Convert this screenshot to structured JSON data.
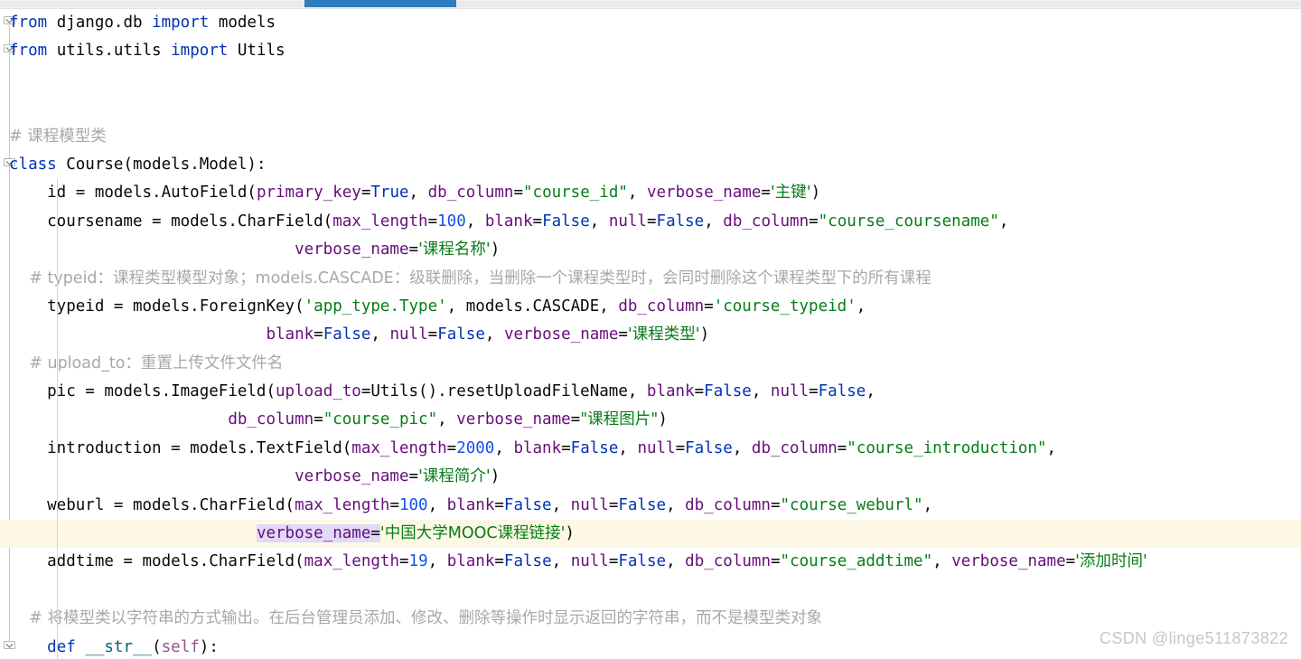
{
  "window": {
    "app": "code-editor",
    "watermark": "CSDN @linge511873822"
  },
  "scrollbar": {
    "orientation": "horizontal",
    "thumb_color": "#2f7cbf",
    "track_color": "#eaeaea"
  },
  "theme": {
    "background": "#ffffff",
    "keyword": "#0033b3",
    "string": "#067d17",
    "number": "#1750eb",
    "kwarg_name": "#660e7a",
    "comment": "#a8a8a8",
    "function": "#00627a",
    "self": "#94558d",
    "caret_line": "#fdf8e5",
    "selection": "#e0d9f7",
    "indent_guide": "#d4d4d4"
  },
  "code": {
    "language": "python",
    "lines": [
      {
        "n": 1,
        "fold": "open",
        "tokens": [
          {
            "t": "from",
            "c": "kw"
          },
          {
            "t": " django.db ",
            "c": "plain"
          },
          {
            "t": "import",
            "c": "kw"
          },
          {
            "t": " models",
            "c": "plain"
          }
        ]
      },
      {
        "n": 2,
        "fold": "open",
        "tokens": [
          {
            "t": "from",
            "c": "kw"
          },
          {
            "t": " utils.utils ",
            "c": "plain"
          },
          {
            "t": "import",
            "c": "kw"
          },
          {
            "t": " Utils",
            "c": "plain"
          }
        ]
      },
      {
        "n": 3,
        "fold": "",
        "tokens": []
      },
      {
        "n": 4,
        "fold": "",
        "tokens": []
      },
      {
        "n": 5,
        "fold": "",
        "tokens": [
          {
            "t": "# 课程模型类",
            "c": "cmt"
          }
        ]
      },
      {
        "n": 6,
        "fold": "open",
        "tokens": [
          {
            "t": "class",
            "c": "kw"
          },
          {
            "t": " Course(models.Model):",
            "c": "plain"
          }
        ]
      },
      {
        "n": 7,
        "fold": "",
        "indent": 1,
        "tokens": [
          {
            "t": "    id = models.AutoField(",
            "c": "plain"
          },
          {
            "t": "primary_key",
            "c": "named"
          },
          {
            "t": "=",
            "c": "plain"
          },
          {
            "t": "True",
            "c": "bool"
          },
          {
            "t": ", ",
            "c": "plain"
          },
          {
            "t": "db_column",
            "c": "named"
          },
          {
            "t": "=",
            "c": "plain"
          },
          {
            "t": "\"course_id\"",
            "c": "str-d"
          },
          {
            "t": ", ",
            "c": "plain"
          },
          {
            "t": "verbose_name",
            "c": "named"
          },
          {
            "t": "=",
            "c": "plain"
          },
          {
            "t": "'主键'",
            "c": "str-s"
          },
          {
            "t": ")",
            "c": "plain"
          }
        ]
      },
      {
        "n": 8,
        "fold": "",
        "indent": 1,
        "tokens": [
          {
            "t": "    coursename = models.CharField(",
            "c": "plain"
          },
          {
            "t": "max_length",
            "c": "named"
          },
          {
            "t": "=",
            "c": "plain"
          },
          {
            "t": "100",
            "c": "num"
          },
          {
            "t": ", ",
            "c": "plain"
          },
          {
            "t": "blank",
            "c": "named"
          },
          {
            "t": "=",
            "c": "plain"
          },
          {
            "t": "False",
            "c": "bool"
          },
          {
            "t": ", ",
            "c": "plain"
          },
          {
            "t": "null",
            "c": "named"
          },
          {
            "t": "=",
            "c": "plain"
          },
          {
            "t": "False",
            "c": "bool"
          },
          {
            "t": ", ",
            "c": "plain"
          },
          {
            "t": "db_column",
            "c": "named"
          },
          {
            "t": "=",
            "c": "plain"
          },
          {
            "t": "\"course_coursename\"",
            "c": "str-d"
          },
          {
            "t": ",",
            "c": "plain"
          }
        ]
      },
      {
        "n": 9,
        "fold": "",
        "indent": 2,
        "tokens": [
          {
            "t": "                              ",
            "c": "plain"
          },
          {
            "t": "verbose_name",
            "c": "named"
          },
          {
            "t": "=",
            "c": "plain"
          },
          {
            "t": "'课程名称'",
            "c": "str-s"
          },
          {
            "t": ")",
            "c": "plain"
          }
        ]
      },
      {
        "n": 10,
        "fold": "",
        "indent": 1,
        "tokens": [
          {
            "t": "    # typeid：课程类型模型对象；models.CASCADE：级联删除，当删除一个课程类型时，会同时删除这个课程类型下的所有课程",
            "c": "cmt"
          }
        ]
      },
      {
        "n": 11,
        "fold": "",
        "indent": 1,
        "tokens": [
          {
            "t": "    typeid = models.ForeignKey(",
            "c": "plain"
          },
          {
            "t": "'app_type.Type'",
            "c": "str-s"
          },
          {
            "t": ", models.CASCADE, ",
            "c": "plain"
          },
          {
            "t": "db_column",
            "c": "named"
          },
          {
            "t": "=",
            "c": "plain"
          },
          {
            "t": "'course_typeid'",
            "c": "str-s"
          },
          {
            "t": ",",
            "c": "plain"
          }
        ]
      },
      {
        "n": 12,
        "fold": "",
        "indent": 2,
        "tokens": [
          {
            "t": "                           ",
            "c": "plain"
          },
          {
            "t": "blank",
            "c": "named"
          },
          {
            "t": "=",
            "c": "plain"
          },
          {
            "t": "False",
            "c": "bool"
          },
          {
            "t": ", ",
            "c": "plain"
          },
          {
            "t": "null",
            "c": "named"
          },
          {
            "t": "=",
            "c": "plain"
          },
          {
            "t": "False",
            "c": "bool"
          },
          {
            "t": ", ",
            "c": "plain"
          },
          {
            "t": "verbose_name",
            "c": "named"
          },
          {
            "t": "=",
            "c": "plain"
          },
          {
            "t": "'课程类型'",
            "c": "str-s"
          },
          {
            "t": ")",
            "c": "plain"
          }
        ]
      },
      {
        "n": 13,
        "fold": "",
        "indent": 1,
        "tokens": [
          {
            "t": "    # upload_to：重置上传文件文件名",
            "c": "cmt"
          }
        ]
      },
      {
        "n": 14,
        "fold": "",
        "indent": 1,
        "tokens": [
          {
            "t": "    pic = models.ImageField(",
            "c": "plain"
          },
          {
            "t": "upload_to",
            "c": "named"
          },
          {
            "t": "=Utils().resetUploadFileName, ",
            "c": "plain"
          },
          {
            "t": "blank",
            "c": "named"
          },
          {
            "t": "=",
            "c": "plain"
          },
          {
            "t": "False",
            "c": "bool"
          },
          {
            "t": ", ",
            "c": "plain"
          },
          {
            "t": "null",
            "c": "named"
          },
          {
            "t": "=",
            "c": "plain"
          },
          {
            "t": "False",
            "c": "bool"
          },
          {
            "t": ",",
            "c": "plain"
          }
        ]
      },
      {
        "n": 15,
        "fold": "",
        "indent": 2,
        "tokens": [
          {
            "t": "                       ",
            "c": "plain"
          },
          {
            "t": "db_column",
            "c": "named"
          },
          {
            "t": "=",
            "c": "plain"
          },
          {
            "t": "\"course_pic\"",
            "c": "str-d"
          },
          {
            "t": ", ",
            "c": "plain"
          },
          {
            "t": "verbose_name",
            "c": "named"
          },
          {
            "t": "=",
            "c": "plain"
          },
          {
            "t": "\"课程图片\"",
            "c": "str-d"
          },
          {
            "t": ")",
            "c": "plain"
          }
        ]
      },
      {
        "n": 16,
        "fold": "",
        "indent": 1,
        "tokens": [
          {
            "t": "    introduction = models.TextField(",
            "c": "plain"
          },
          {
            "t": "max_length",
            "c": "named"
          },
          {
            "t": "=",
            "c": "plain"
          },
          {
            "t": "2000",
            "c": "num"
          },
          {
            "t": ", ",
            "c": "plain"
          },
          {
            "t": "blank",
            "c": "named"
          },
          {
            "t": "=",
            "c": "plain"
          },
          {
            "t": "False",
            "c": "bool"
          },
          {
            "t": ", ",
            "c": "plain"
          },
          {
            "t": "null",
            "c": "named"
          },
          {
            "t": "=",
            "c": "plain"
          },
          {
            "t": "False",
            "c": "bool"
          },
          {
            "t": ", ",
            "c": "plain"
          },
          {
            "t": "db_column",
            "c": "named"
          },
          {
            "t": "=",
            "c": "plain"
          },
          {
            "t": "\"course_introduction\"",
            "c": "str-d"
          },
          {
            "t": ",",
            "c": "plain"
          }
        ]
      },
      {
        "n": 17,
        "fold": "",
        "indent": 2,
        "tokens": [
          {
            "t": "                              ",
            "c": "plain"
          },
          {
            "t": "verbose_name",
            "c": "named"
          },
          {
            "t": "=",
            "c": "plain"
          },
          {
            "t": "'课程简介'",
            "c": "str-s"
          },
          {
            "t": ")",
            "c": "plain"
          }
        ]
      },
      {
        "n": 18,
        "fold": "",
        "indent": 1,
        "tokens": [
          {
            "t": "    weburl = models.CharField(",
            "c": "plain"
          },
          {
            "t": "max_length",
            "c": "named"
          },
          {
            "t": "=",
            "c": "plain"
          },
          {
            "t": "100",
            "c": "num"
          },
          {
            "t": ", ",
            "c": "plain"
          },
          {
            "t": "blank",
            "c": "named"
          },
          {
            "t": "=",
            "c": "plain"
          },
          {
            "t": "False",
            "c": "bool"
          },
          {
            "t": ", ",
            "c": "plain"
          },
          {
            "t": "null",
            "c": "named"
          },
          {
            "t": "=",
            "c": "plain"
          },
          {
            "t": "False",
            "c": "bool"
          },
          {
            "t": ", ",
            "c": "plain"
          },
          {
            "t": "db_column",
            "c": "named"
          },
          {
            "t": "=",
            "c": "plain"
          },
          {
            "t": "\"course_weburl\"",
            "c": "str-d"
          },
          {
            "t": ",",
            "c": "plain"
          }
        ]
      },
      {
        "n": 19,
        "fold": "",
        "indent": 2,
        "caret": true,
        "selection": "verbose_name=",
        "tokens": [
          {
            "t": "                          ",
            "c": "plain"
          },
          {
            "t": "verbose_name",
            "c": "named sel"
          },
          {
            "t": "=",
            "c": "plain sel"
          },
          {
            "t": "'中国大学MOOC课程链接'",
            "c": "str-s"
          },
          {
            "t": ")",
            "c": "plain"
          }
        ]
      },
      {
        "n": 20,
        "fold": "",
        "indent": 1,
        "tokens": [
          {
            "t": "    addtime = models.CharField(",
            "c": "plain"
          },
          {
            "t": "max_length",
            "c": "named"
          },
          {
            "t": "=",
            "c": "plain"
          },
          {
            "t": "19",
            "c": "num"
          },
          {
            "t": ", ",
            "c": "plain"
          },
          {
            "t": "blank",
            "c": "named"
          },
          {
            "t": "=",
            "c": "plain"
          },
          {
            "t": "False",
            "c": "bool"
          },
          {
            "t": ", ",
            "c": "plain"
          },
          {
            "t": "null",
            "c": "named"
          },
          {
            "t": "=",
            "c": "plain"
          },
          {
            "t": "False",
            "c": "bool"
          },
          {
            "t": ", ",
            "c": "plain"
          },
          {
            "t": "db_column",
            "c": "named"
          },
          {
            "t": "=",
            "c": "plain"
          },
          {
            "t": "\"course_addtime\"",
            "c": "str-d"
          },
          {
            "t": ", ",
            "c": "plain"
          },
          {
            "t": "verbose_name",
            "c": "named"
          },
          {
            "t": "=",
            "c": "plain"
          },
          {
            "t": "'添加时间'",
            "c": "str-s"
          }
        ]
      },
      {
        "n": 21,
        "fold": "",
        "indent": 1,
        "tokens": []
      },
      {
        "n": 22,
        "fold": "",
        "indent": 1,
        "tokens": [
          {
            "t": "    # 将模型类以字符串的方式输出。在后台管理员添加、修改、删除等操作时显示返回的字符串，而不是模型类对象",
            "c": "cmt"
          }
        ]
      },
      {
        "n": 23,
        "fold": "open",
        "indent": 1,
        "tokens": [
          {
            "t": "    ",
            "c": "plain"
          },
          {
            "t": "def",
            "c": "kw"
          },
          {
            "t": " ",
            "c": "plain"
          },
          {
            "t": "__str__",
            "c": "fn"
          },
          {
            "t": "(",
            "c": "plain"
          },
          {
            "t": "self",
            "c": "self"
          },
          {
            "t": "):",
            "c": "plain"
          }
        ]
      }
    ]
  }
}
